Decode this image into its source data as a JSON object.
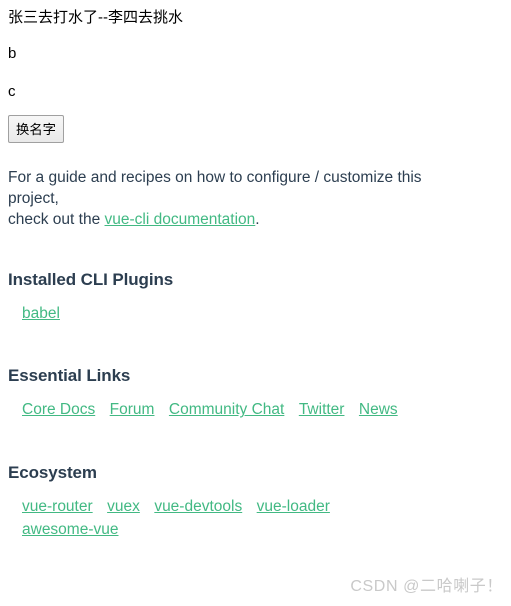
{
  "custom": {
    "title_line": "张三去打水了--李四去挑水",
    "line_b": "b",
    "line_c": "c",
    "rename_button_label": "换名字"
  },
  "hello": {
    "intro_text_part1": "For a guide and recipes on how to configure / customize this project,",
    "intro_text_part2": "check out the ",
    "intro_link_label": "vue-cli documentation",
    "intro_text_part3": ".",
    "headings": {
      "installed_plugins": "Installed CLI Plugins",
      "essential_links": "Essential Links",
      "ecosystem": "Ecosystem"
    },
    "plugins": [
      {
        "label": "babel"
      }
    ],
    "essential_links": [
      {
        "label": "Core Docs"
      },
      {
        "label": "Forum"
      },
      {
        "label": "Community Chat"
      },
      {
        "label": "Twitter"
      },
      {
        "label": "News"
      }
    ],
    "ecosystem_links_row1": [
      {
        "label": "vue-router"
      },
      {
        "label": "vuex"
      },
      {
        "label": "vue-devtools"
      },
      {
        "label": "vue-loader"
      }
    ],
    "ecosystem_links_row2": [
      {
        "label": "awesome-vue"
      }
    ]
  },
  "watermark": {
    "text": "CSDN @二哈喇子！"
  },
  "colors": {
    "link_green": "#42b983",
    "heading_dark": "#2c3e50",
    "watermark_gray": "#c9c9c9",
    "page_background": "#ffffff"
  }
}
